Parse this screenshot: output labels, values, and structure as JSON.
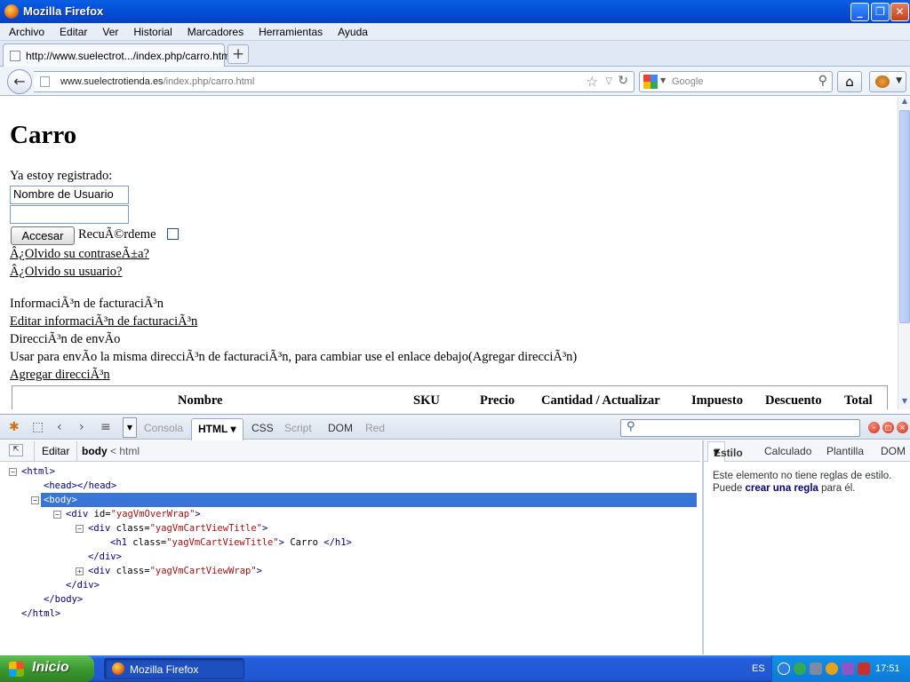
{
  "window": {
    "title": "Mozilla Firefox"
  },
  "menu": [
    "Archivo",
    "Editar",
    "Ver",
    "Historial",
    "Marcadores",
    "Herramientas",
    "Ayuda"
  ],
  "tab": {
    "label": "http://www.suelectrot.../index.php/carro.html",
    "new_tab": "+"
  },
  "nav": {
    "url_domain": "www.suelectrotienda.es",
    "url_path": "/index.php/carro.html",
    "search_placeholder": "Google"
  },
  "page": {
    "title": "Carro",
    "registered_label": "Ya estoy registrado:",
    "username_value": "Nombre de Usuario",
    "password_value": "",
    "login_button": "Accesar",
    "remember_label": "RecuÃ©rdeme",
    "forgot_password": "Â¿Olvido su contraseÃ±a?",
    "forgot_user": "Â¿Olvido su usuario?",
    "billing_info": "InformaciÃ³n de facturaciÃ³n",
    "edit_billing": "Editar informaciÃ³n de facturaciÃ³n",
    "shipping_address": "DirecciÃ³n de envÃo",
    "shipping_note": "Usar para envÃo la misma direcciÃ³n de facturaciÃ³n, para cambiar use el enlace debajo(Agregar direcciÃ³n)",
    "add_address": "Agregar direcciÃ³n",
    "table_headers": [
      "Nombre",
      "SKU",
      "Precio",
      "Cantidad / Actualizar",
      "Impuesto",
      "Descuento",
      "Total"
    ]
  },
  "firebug": {
    "tabs": [
      "Consola",
      "HTML",
      "CSS",
      "Script",
      "DOM",
      "Red"
    ],
    "crumb_edit": "Editar",
    "crumb_body": "body",
    "crumb_sep": "<",
    "crumb_html": "html",
    "side_tabs": [
      "Estilo",
      "Calculado",
      "Plantilla",
      "DOM"
    ],
    "side_msg_pre": "Este elemento no tiene reglas de estilo. Puede ",
    "side_msg_link": "crear una regla",
    "side_msg_post": " para él.",
    "tree": {
      "html_open": "<html>",
      "head": "<head></head>",
      "body_open": "<body>",
      "div_over_tag": "<div",
      "div_over_attr": " id=",
      "div_over_val": "\"yagVmOverWrap\"",
      "div_over_end": ">",
      "div_title_tag": "<div",
      "div_title_attr": " class=",
      "div_title_val": "\"yagVmCartViewTitle\"",
      "div_title_end": ">",
      "h1_tag": "<h1",
      "h1_attr": " class=",
      "h1_val": "\"yagVmCartViewTitle\"",
      "h1_mid": ">",
      "h1_text": " Carro ",
      "h1_close": "</h1>",
      "div_close1": "</div>",
      "div_wrap_tag": "<div",
      "div_wrap_attr": " class=",
      "div_wrap_val": "\"yagVmCartViewWrap\"",
      "div_wrap_end": ">",
      "div_close2": "</div>",
      "body_close": "</body>",
      "html_close": "</html>"
    }
  },
  "taskbar": {
    "start": "Inicio",
    "item": "Mozilla Firefox",
    "lang": "ES",
    "clock": "17:51"
  }
}
